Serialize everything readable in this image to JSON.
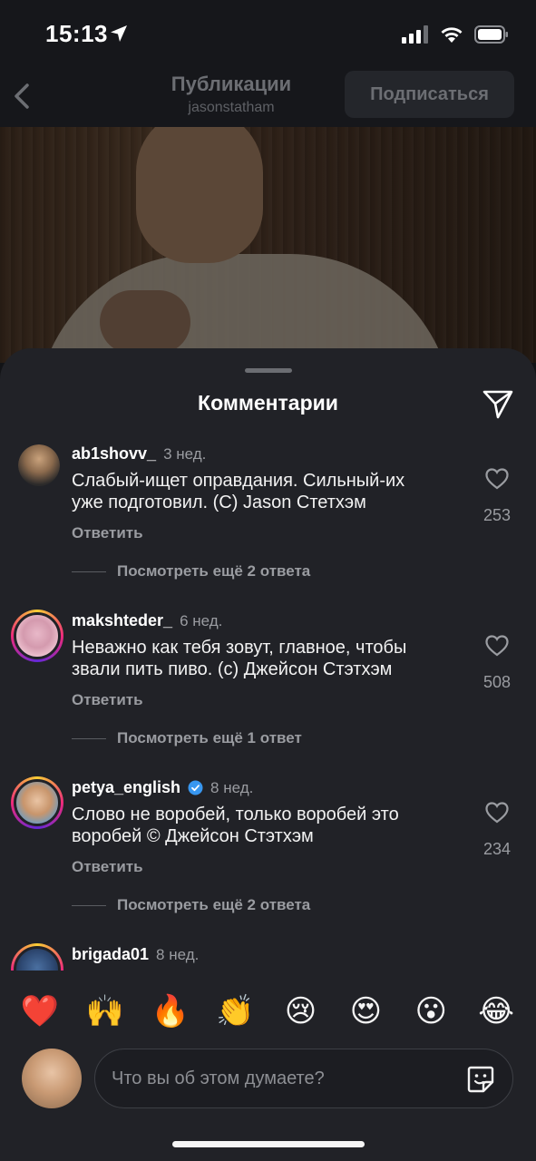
{
  "status": {
    "time": "15:13"
  },
  "nav": {
    "title": "Публикации",
    "subtitle": "jasonstatham",
    "follow_label": "Подписаться"
  },
  "sheet": {
    "title": "Комментарии"
  },
  "comments": [
    {
      "user": "ab1shovv_",
      "time": "3 нед.",
      "text_line1": "Слабый-ищет оправдания. Сильный-их",
      "text_line2": "уже подготовил. (С) Jason Стетхэм",
      "reply_label": "Ответить",
      "more_label": "Посмотреть ещё 2 ответа",
      "likes": "253"
    },
    {
      "user": "makshteder_",
      "time": "6 нед.",
      "text_line1": "Неважно как тебя зовут, главное, чтобы",
      "text_line2": "звали пить пиво. (с) Джейсон Стэтхэм",
      "reply_label": "Ответить",
      "more_label": "Посмотреть ещё 1 ответ",
      "likes": "508"
    },
    {
      "user": "petya_english",
      "time": "8 нед.",
      "text_line1": "Слово не воробей, только воробей это",
      "text_line2": "воробей © Джейсон Стэтхэм",
      "reply_label": "Ответить",
      "more_label": "Посмотреть ещё 2 ответа",
      "likes": "234"
    },
    {
      "user": "brigada01",
      "time": "8 нед."
    }
  ],
  "emojis": [
    "❤️",
    "🙌",
    "🔥",
    "👏",
    "😢",
    "😍",
    "😮",
    "😂"
  ],
  "comment_input": {
    "placeholder": "Что вы об этом думаете?"
  },
  "icons": {
    "back": "chevron-left-icon",
    "share": "paper-plane-icon",
    "like": "heart-outline-icon",
    "verified": "verified-badge-icon",
    "sticker": "sticker-icon"
  },
  "colors": {
    "accent_verified": "#3897f0",
    "sheet_bg": "#212227"
  }
}
